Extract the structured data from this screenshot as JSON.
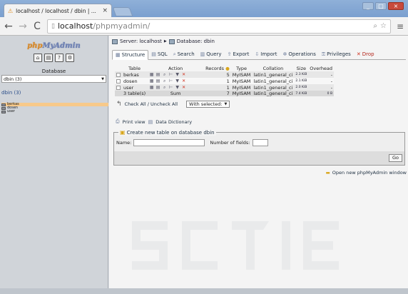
{
  "browser": {
    "tab_title": "localhost / localhost / dbin | ...",
    "tab_close": "×",
    "url_host": "localhost",
    "url_path": "/phpmyadmin/",
    "window_buttons": [
      "_",
      "□",
      "×"
    ]
  },
  "sidebar": {
    "logo_php": "php",
    "logo_myadmin": "MyAdmin",
    "icon_buttons": [
      "⌂",
      "▤",
      "?",
      "⚙"
    ],
    "database_label": "Database",
    "database_select": "dbin (3)",
    "db_link": "dbin (3)",
    "tables": [
      {
        "name": "berkas",
        "active": true
      },
      {
        "name": "dosen",
        "active": false
      },
      {
        "name": "user",
        "active": false
      }
    ]
  },
  "main": {
    "breadcrumb_server": "Server: localhost",
    "breadcrumb_sep": "▶",
    "breadcrumb_db": "Database: dbin",
    "tabs": [
      {
        "label": "Structure",
        "icon": "▦",
        "active": true
      },
      {
        "label": "SQL",
        "icon": "▤"
      },
      {
        "label": "Search",
        "icon": "⌕"
      },
      {
        "label": "Query",
        "icon": "▥"
      },
      {
        "label": "Export",
        "icon": "⇪"
      },
      {
        "label": "Import",
        "icon": "⇩"
      },
      {
        "label": "Operations",
        "icon": "✲"
      },
      {
        "label": "Privileges",
        "icon": "⚿"
      },
      {
        "label": "Drop",
        "icon": "✕",
        "danger": true
      }
    ],
    "table_headers": [
      "Table",
      "Action",
      "Records",
      "Type",
      "Collation",
      "Size",
      "Overhead"
    ],
    "rows": [
      {
        "name": "berkas",
        "records": "5",
        "type": "MyISAM",
        "collation": "latin1_general_ci",
        "size": "2.3 KiB",
        "overhead": "-"
      },
      {
        "name": "dosen",
        "records": "1",
        "type": "MyISAM",
        "collation": "latin1_general_ci",
        "size": "2.1 KiB",
        "overhead": "-"
      },
      {
        "name": "user",
        "records": "1",
        "type": "MyISAM",
        "collation": "latin1_general_ci",
        "size": "2.0 KiB",
        "overhead": "-"
      }
    ],
    "footer": {
      "tables": "3 table(s)",
      "sum": "Sum",
      "records": "7",
      "type": "MyISAM",
      "collation": "latin1_general_ci",
      "size": "7.4 KiB",
      "overhead": "0 B"
    },
    "check_all": "Check All / Uncheck All",
    "with_selected": "With selected:",
    "print_view": "Print view",
    "data_dictionary": "Data Dictionary",
    "create_legend": "Create new table on database dbin",
    "name_label": "Name:",
    "fields_label": "Number of fields:",
    "go_button": "Go",
    "open_window": "Open new phpMyAdmin window"
  }
}
